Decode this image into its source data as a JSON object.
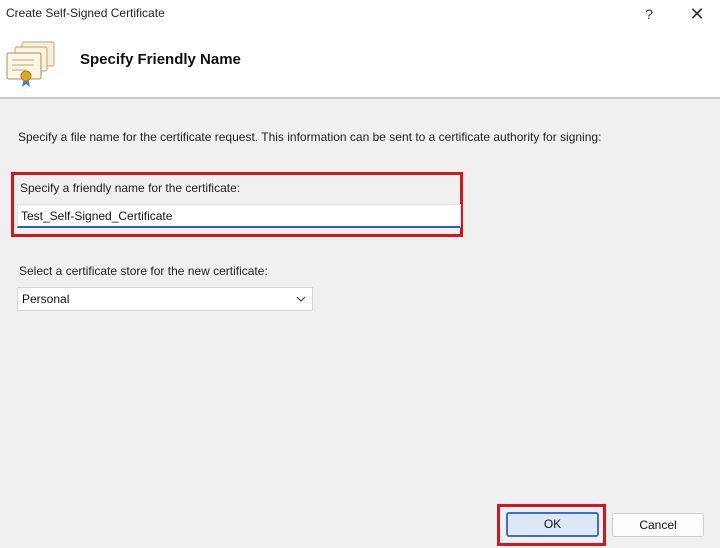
{
  "window": {
    "title": "Create Self-Signed Certificate",
    "help_label": "?",
    "close_label": "✕"
  },
  "header": {
    "title": "Specify Friendly Name",
    "icon": "certificate-icon"
  },
  "content": {
    "intro": "Specify a file name for the certificate request.  This information can be sent to a certificate authority for signing:",
    "friendly_name_label": "Specify a friendly name for the certificate:",
    "friendly_name_value": "Test_Self-Signed_Certificate",
    "store_label": "Select a certificate store for the new certificate:",
    "store_selected": "Personal"
  },
  "buttons": {
    "ok": "OK",
    "cancel": "Cancel"
  },
  "colors": {
    "highlight": "#d8141e",
    "accent": "#1e63c4"
  }
}
